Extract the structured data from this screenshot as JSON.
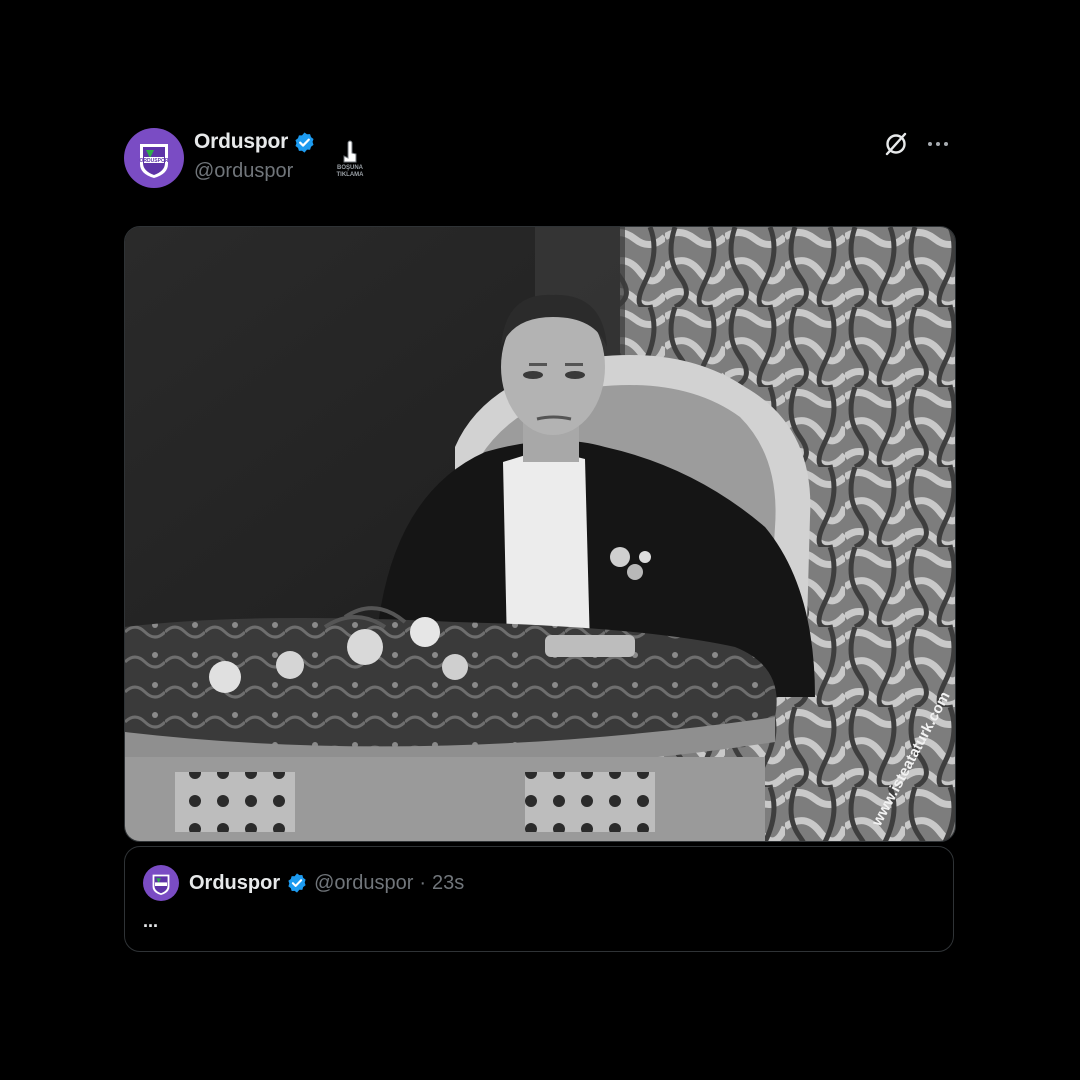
{
  "tweet": {
    "author": {
      "name": "Orduspor",
      "handle": "@orduspor",
      "verified": true
    },
    "avatar_text": "ORDUSPOR",
    "sticker_text": [
      "BOŞUNA",
      "TIKLAMA"
    ],
    "header_icons": [
      "grok-icon",
      "more-options-icon"
    ],
    "media": {
      "watermark": "www.isteataturk.com",
      "style": "black-and-white photograph"
    },
    "quote": {
      "name": "Orduspor",
      "handle": "@orduspor",
      "separator": "·",
      "time": "23s",
      "text": "..."
    }
  },
  "colors": {
    "background": "#000000",
    "text_primary": "#e7e9ea",
    "text_secondary": "#71767b",
    "verified_blue": "#1d9bf0",
    "brand_purple": "#6a3fb5",
    "border": "#2f3336"
  }
}
